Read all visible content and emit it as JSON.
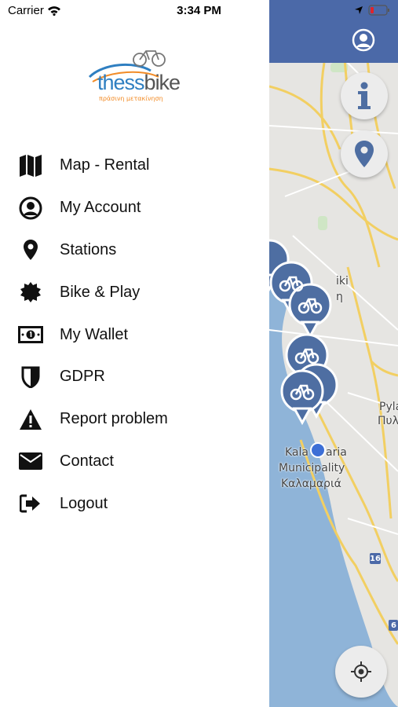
{
  "status_bar": {
    "carrier": "Carrier",
    "time": "3:34 PM"
  },
  "logo": {
    "brand_prefix": "thess",
    "brand_suffix": "bike",
    "tagline": "πράσινη μετακίνηση"
  },
  "menu": {
    "items": [
      {
        "label": "Map - Rental",
        "icon": "map-icon"
      },
      {
        "label": "My Account",
        "icon": "account-icon"
      },
      {
        "label": "Stations",
        "icon": "location-pin-icon"
      },
      {
        "label": "Bike & Play",
        "icon": "badge-icon"
      },
      {
        "label": "My Wallet",
        "icon": "wallet-icon"
      },
      {
        "label": "GDPR",
        "icon": "shield-icon"
      },
      {
        "label": "Report problem",
        "icon": "warning-icon"
      },
      {
        "label": "Contact",
        "icon": "envelope-icon"
      },
      {
        "label": "Logout",
        "icon": "logout-icon"
      }
    ]
  },
  "map": {
    "labels": {
      "kalamaria_partial": "Kala",
      "kalamaria_partial2": "aria",
      "municipality": "Municipality",
      "kalamaria_greek": "Καλαμαριά",
      "pyla": "Pyla",
      "pyla_greek": "Πυλ",
      "thessaloniki_partial": "iki",
      "thessaloniki_greek_partial": "η",
      "road_16": "16",
      "road_6": "6"
    }
  },
  "colors": {
    "header": "#4b69a8",
    "marker": "#4e6ea2",
    "water": "#8fb4d8",
    "accent_logo": "#2f7fc1",
    "accent_orange": "#f28c28"
  }
}
